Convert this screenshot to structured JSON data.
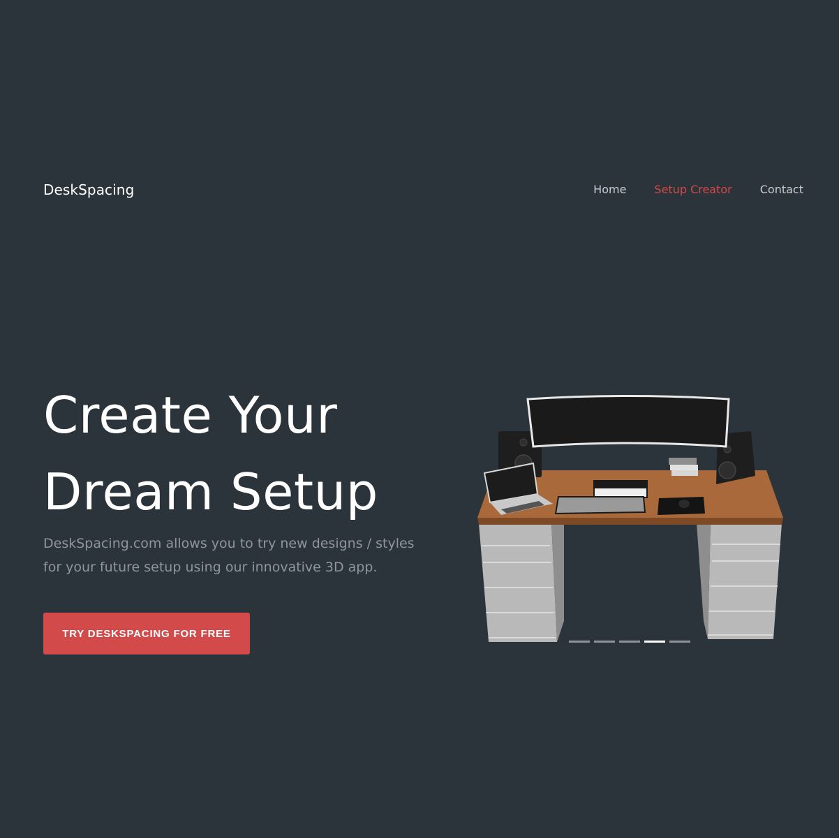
{
  "header": {
    "brand": "DeskSpacing",
    "nav": [
      {
        "label": "Home",
        "active": false
      },
      {
        "label": "Setup Creator",
        "active": true
      },
      {
        "label": "Contact",
        "active": false
      }
    ]
  },
  "hero": {
    "headline_line1": "Create Your",
    "headline_line2": "Dream Setup",
    "subtitle": "DeskSpacing.com allows you to try new designs / styles for your future setup using our innovative 3D app.",
    "cta_label": "TRY DESKSPACING FOR FREE"
  },
  "carousel": {
    "slide_count": 5,
    "active_index": 3
  },
  "colors": {
    "background": "#2c343b",
    "accent": "#d24a4a",
    "text": "#ffffff",
    "muted_text": "#8e959c"
  }
}
